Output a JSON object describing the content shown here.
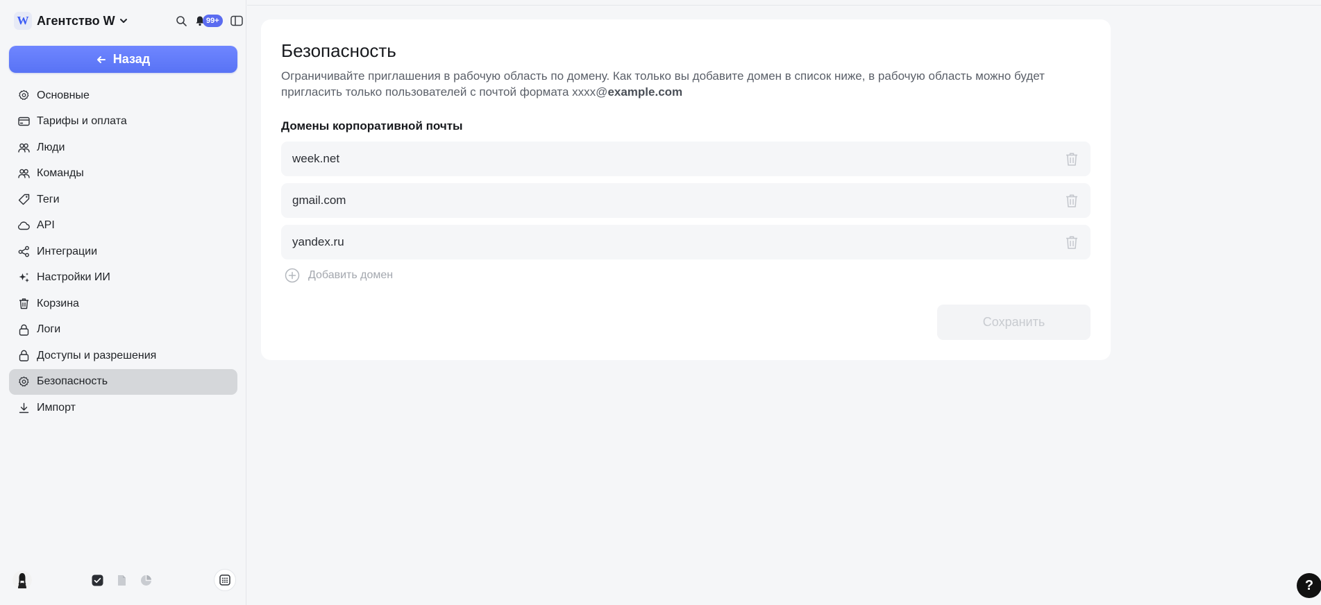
{
  "workspace": {
    "logo_letter": "W",
    "name": "Агентство W",
    "notifications_badge": "99+"
  },
  "sidebar": {
    "back_label": "Назад",
    "items": [
      {
        "label": "Основные",
        "icon": "gear-icon"
      },
      {
        "label": "Тарифы и оплата",
        "icon": "card-icon"
      },
      {
        "label": "Люди",
        "icon": "people-icon"
      },
      {
        "label": "Команды",
        "icon": "people-icon"
      },
      {
        "label": "Теги",
        "icon": "tag-icon"
      },
      {
        "label": "API",
        "icon": "cloud-icon"
      },
      {
        "label": "Интеграции",
        "icon": "share-icon"
      },
      {
        "label": "Настройки ИИ",
        "icon": "sparkles-icon"
      },
      {
        "label": "Корзина",
        "icon": "trash-icon"
      },
      {
        "label": "Логи",
        "icon": "lock-icon"
      },
      {
        "label": "Доступы и разрешения",
        "icon": "lock-icon"
      },
      {
        "label": "Безопасность",
        "icon": "gear-icon",
        "active": true
      },
      {
        "label": "Импорт",
        "icon": "download-icon"
      }
    ]
  },
  "main": {
    "title": "Безопасность",
    "description_prefix": "Ограничивайте приглашения в рабочую область по домену. Как только вы добавите домен в список ниже, в рабочую область можно будет пригласить только пользователей с почтой формата xxxx@",
    "description_bold": "example.com",
    "section_label": "Домены корпоративной почты",
    "domains": [
      "week.net",
      "gmail.com",
      "yandex.ru"
    ],
    "add_domain_label": "Добавить домен",
    "save_label": "Сохранить"
  },
  "help_label": "?",
  "colors": {
    "accent": "#5b6cf0",
    "active_item_bg": "#d5d7da",
    "page_bg": "#f5f6f8"
  }
}
